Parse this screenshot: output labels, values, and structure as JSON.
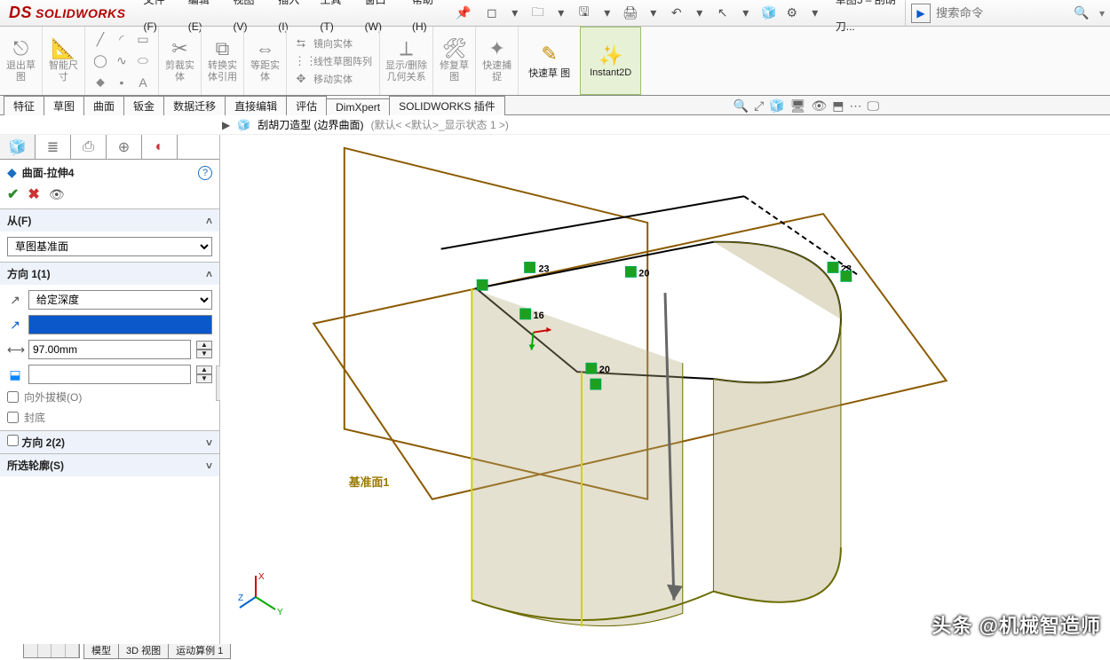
{
  "app": {
    "brand": "SOLIDWORKS",
    "doc_label": "草图5 – 刮胡刀..."
  },
  "menus": [
    "文件(F)",
    "编辑(E)",
    "视图(V)",
    "插入(I)",
    "工具(T)",
    "窗口(W)",
    "帮助(H)"
  ],
  "search": {
    "placeholder": "搜索命令"
  },
  "ribbon": {
    "exit_sketch": "退出草\n图",
    "smart_dim": "智能尺\n寸",
    "trim": "剪裁实\n体",
    "convert": "转换实\n体引用",
    "offset": "等距实\n体",
    "mirror": "镜向实体",
    "linear_pattern": "线性草图阵列",
    "move": "移动实体",
    "relations": "显示/删除\n几何关系",
    "repair": "修复草\n图",
    "quick_snap": "快速捕\n捉",
    "rapid_sketch": "快速草\n图",
    "instant2d": "Instant2D"
  },
  "cmd_tabs": [
    "特征",
    "草图",
    "曲面",
    "钣金",
    "数据迁移",
    "直接编辑",
    "评估",
    "DimXpert",
    "SOLIDWORKS 插件"
  ],
  "cmd_tabs_active": 1,
  "part_path": {
    "name": "刮胡刀造型 (边界曲面)",
    "config": "(默认< <默认>_显示状态 1 >)"
  },
  "feature": {
    "name": "曲面-拉伸4",
    "from_section": "从(F)",
    "from_value": "草图基准面",
    "dir1_section": "方向 1(1)",
    "dir1_end": "给定深度",
    "dir1_depth": "97.00mm",
    "draft_outward": "向外拔模(O)",
    "cap_end": "封底",
    "dir2_section": "方向 2(2)",
    "contours_section": "所选轮廓(S)"
  },
  "viewport": {
    "plane_label": "基准面1",
    "dims": {
      "d1": "23",
      "d2": "20",
      "d3": "16",
      "d4": "20",
      "d5": "23"
    }
  },
  "bottom_tabs": [
    "模型",
    "3D 视图",
    "运动算例 1"
  ],
  "watermark": "头条 @机械智造师"
}
